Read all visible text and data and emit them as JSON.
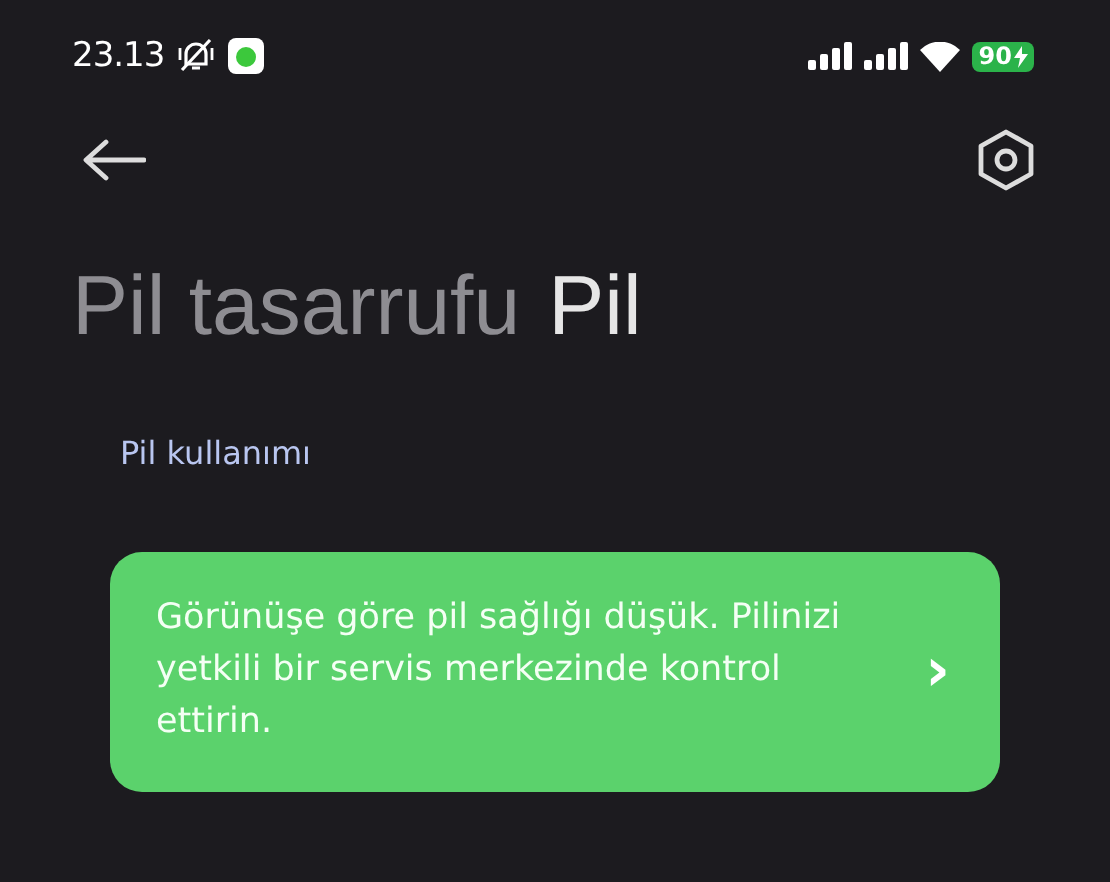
{
  "status_bar": {
    "time": "23.13",
    "notifications_muted": true,
    "app_badge": true,
    "battery": "90",
    "charging": true
  },
  "header": {
    "titles": [
      {
        "text": "Pil tasarrufu",
        "kind": "fading"
      },
      {
        "text": "Pil",
        "kind": "current"
      }
    ]
  },
  "section": {
    "label": "Pil kullanımı"
  },
  "alert_card": {
    "message": "Görünüşe göre pil sağlığı düşük. Pilinizi yetkili bir servis merkezinde kontrol ettirin.",
    "chevron": "›"
  }
}
